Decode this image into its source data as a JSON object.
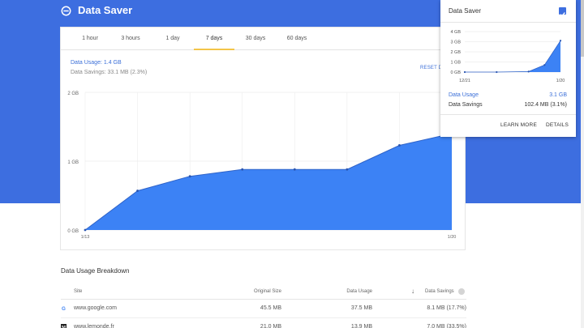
{
  "app": {
    "title": "Data Saver",
    "logo_icon": "data-saver-logo-icon"
  },
  "colors": {
    "banner": "#3d6ee0",
    "accent": "#3b6fd8",
    "area_fill": "#3c82f5",
    "tab_underline": "#f3c548"
  },
  "tabs": [
    {
      "label": "1 hour",
      "active": false
    },
    {
      "label": "3 hours",
      "active": false
    },
    {
      "label": "1 day",
      "active": false
    },
    {
      "label": "7 days",
      "active": true
    },
    {
      "label": "30 days",
      "active": false
    },
    {
      "label": "60 days",
      "active": false
    }
  ],
  "summary": {
    "usage_text": "Data Usage: 1.4 GB",
    "savings_text": "Data Savings: 33.1 MB (2.3%)",
    "reset_label": "RESET D"
  },
  "chart_data": {
    "type": "area",
    "y_ticks": [
      "2 GB",
      "1 GB",
      "0 GB"
    ],
    "ylim": [
      0,
      2
    ],
    "x_start_label": "1/13",
    "x_end_label": "1/20",
    "x": [
      0,
      1,
      2,
      3,
      4,
      5,
      6,
      7
    ],
    "values": [
      0.0,
      0.57,
      0.78,
      0.88,
      0.88,
      0.88,
      1.23,
      1.4
    ],
    "grid": true
  },
  "breakdown": {
    "title": "Data Usage Breakdown",
    "headers": {
      "site": "Site",
      "original": "Original Size",
      "usage": "Data Usage",
      "savings": "Data Savings"
    },
    "sort_icon": "arrow-down-icon",
    "help_icon": "help-icon",
    "rows": [
      {
        "icon": "google-favicon-icon",
        "site": "www.google.com",
        "original": "45.5 MB",
        "usage": "37.5 MB",
        "savings": "8.1 MB (17.7%)"
      },
      {
        "icon": "lemonde-favicon-icon",
        "site": "www.lemonde.fr",
        "original": "21.0 MB",
        "usage": "13.9 MB",
        "savings": "7.0 MB (33.5%)"
      }
    ]
  },
  "popup": {
    "title": "Data Saver",
    "enabled": true,
    "mini_chart": {
      "type": "area",
      "y_ticks": [
        "4 GB",
        "3 GB",
        "2 GB",
        "1 GB",
        "0 GB"
      ],
      "ylim": [
        0,
        4
      ],
      "x_start_label": "12/21",
      "x_end_label": "1/20",
      "x": [
        0,
        2,
        4,
        5,
        6
      ],
      "values": [
        0.0,
        0.0,
        0.05,
        0.7,
        3.1
      ]
    },
    "usage_label": "Data Usage",
    "usage_value": "3.1 GB",
    "savings_label": "Data Savings",
    "savings_value": "102.4 MB (3.1%)",
    "learn_more_label": "LEARN MORE",
    "details_label": "DETAILS"
  }
}
